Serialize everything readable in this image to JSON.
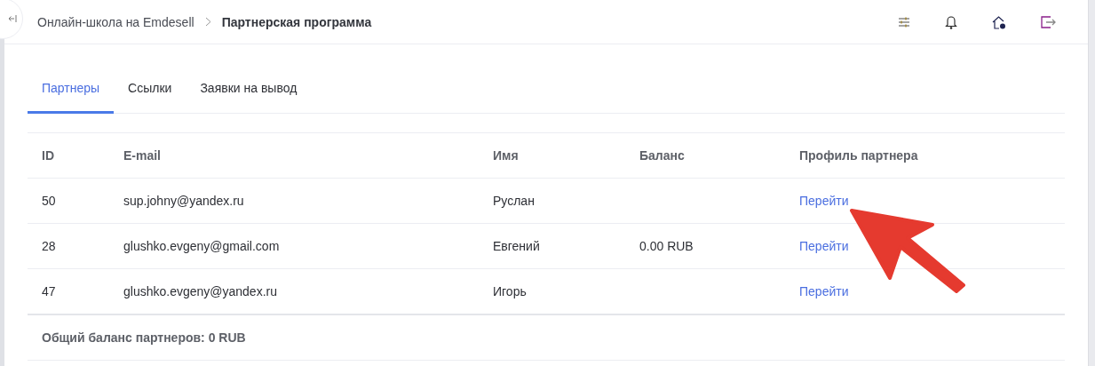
{
  "breadcrumbs": [
    {
      "label": "Онлайн-школа на Emdesell",
      "current": false
    },
    {
      "label": "Партнерская программа",
      "current": true
    }
  ],
  "tabs": [
    {
      "label": "Партнеры",
      "selected": true
    },
    {
      "label": "Ссылки",
      "selected": false
    },
    {
      "label": "Заявки на вывод",
      "selected": false
    }
  ],
  "table": {
    "columns": [
      "ID",
      "E-mail",
      "Имя",
      "Баланс",
      "Профиль партнера"
    ],
    "rows": [
      {
        "id": "50",
        "email": "sup.johny@yandex.ru",
        "name": "Руслан",
        "link": "Перейти"
      },
      {
        "id": "28",
        "email": "glushko.evgeny@gmail.com",
        "name": "Евгений",
        "balance": "0.00 RUB",
        "link": "Перейти"
      },
      {
        "id": "47",
        "email": "glushko.evgeny@yandex.ru",
        "name": "Игорь",
        "link": "Перейти"
      }
    ],
    "footer": "Общий баланс партнеров: 0 RUB"
  }
}
